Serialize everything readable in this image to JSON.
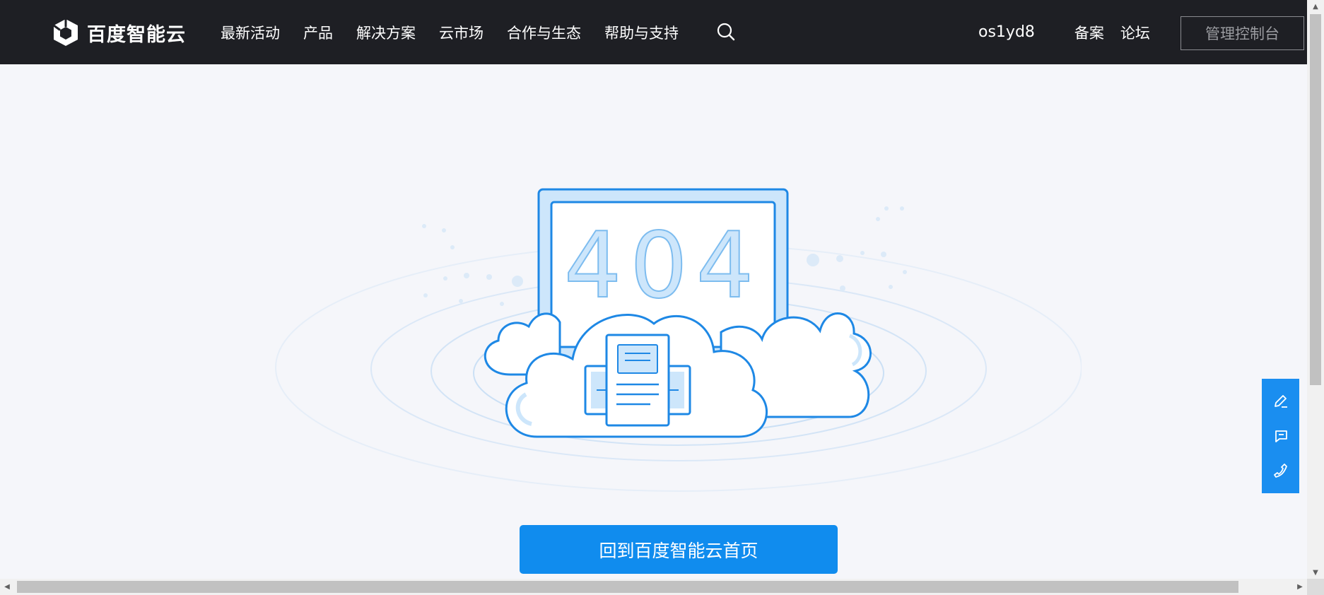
{
  "header": {
    "logo_text": "百度智能云",
    "nav": [
      {
        "label": "最新活动"
      },
      {
        "label": "产品"
      },
      {
        "label": "解决方案"
      },
      {
        "label": "云市场"
      },
      {
        "label": "合作与生态"
      },
      {
        "label": "帮助与支持"
      }
    ],
    "search_icon": "search-icon",
    "username": "os1yd8",
    "link_beian": "备案",
    "link_forum": "论坛",
    "console_button": "管理控制台"
  },
  "error": {
    "code_text": "404",
    "home_button": "回到百度智能云首页"
  },
  "float_toolbar": {
    "icons": [
      "edit-icon",
      "feedback-icon",
      "phone-icon"
    ]
  },
  "colors": {
    "header_bg": "#1e1f24",
    "page_bg": "#f5f6fa",
    "accent": "#108cee",
    "illustration_stroke": "#1e88e5",
    "illustration_fill": "#cde6fb"
  }
}
